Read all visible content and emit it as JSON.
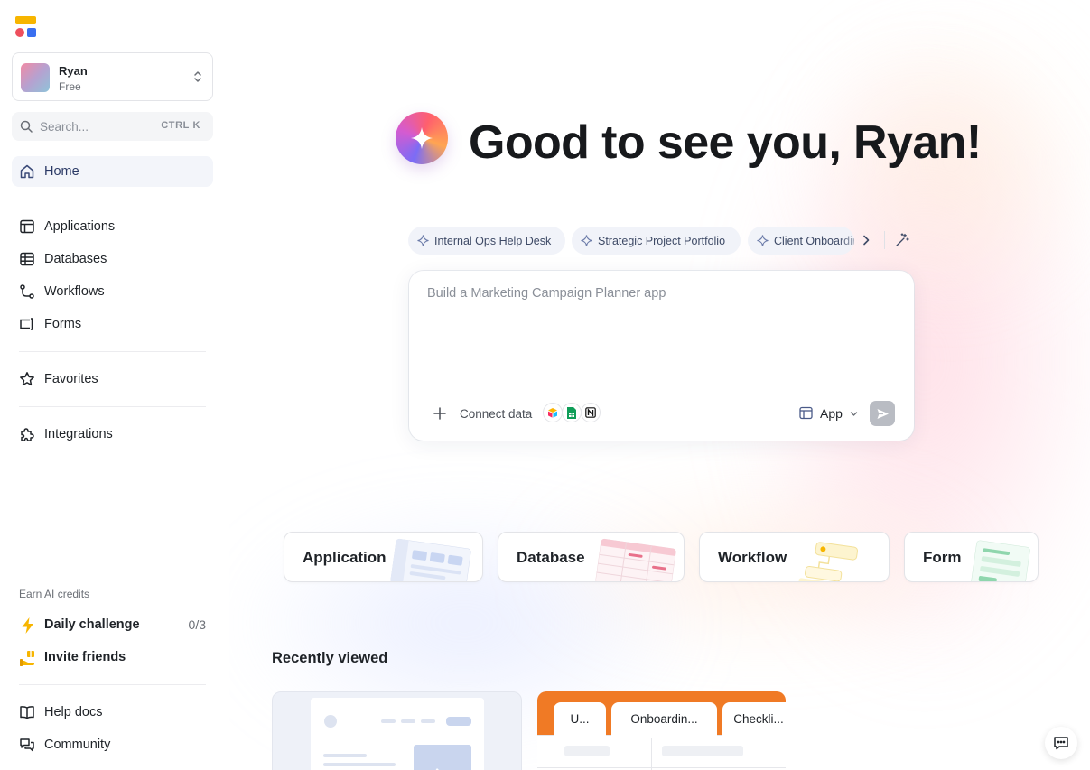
{
  "sidebar": {
    "workspace": {
      "name": "Ryan",
      "plan": "Free"
    },
    "search": {
      "placeholder": "Search...",
      "shortcut": "CTRL K"
    },
    "home": {
      "label": "Home",
      "icon": "home-icon"
    },
    "items": [
      {
        "label": "Applications",
        "icon": "applications-icon"
      },
      {
        "label": "Databases",
        "icon": "databases-icon"
      },
      {
        "label": "Workflows",
        "icon": "workflows-icon"
      },
      {
        "label": "Forms",
        "icon": "forms-icon"
      }
    ],
    "favorites": {
      "label": "Favorites",
      "icon": "star-icon"
    },
    "integrations": {
      "label": "Integrations",
      "icon": "puzzle-icon"
    },
    "earn": {
      "title": "Earn AI credits",
      "daily": {
        "label": "Daily challenge",
        "count": "0/3",
        "icon": "lightning-icon"
      },
      "invite": {
        "label": "Invite friends",
        "icon": "gift-hand-icon"
      }
    },
    "help": {
      "label": "Help docs",
      "icon": "book-icon"
    },
    "community": {
      "label": "Community",
      "icon": "chat-bubbles-icon"
    }
  },
  "main": {
    "greeting": "Good to see you, Ryan!",
    "suggestions": [
      {
        "label": "Internal Ops Help Desk"
      },
      {
        "label": "Strategic Project Portfolio"
      },
      {
        "label": "Client Onboarding"
      }
    ],
    "prompt": {
      "placeholder": "Build a Marketing Campaign Planner app",
      "connect_label": "Connect data",
      "type_label": "App"
    },
    "types": [
      {
        "label": "Application"
      },
      {
        "label": "Database"
      },
      {
        "label": "Workflow"
      },
      {
        "label": "Form"
      }
    ],
    "recent_title": "Recently viewed",
    "recent_tabs": [
      "U...",
      "Onboardin...",
      "Checkli..."
    ]
  },
  "colors": {
    "accent_orange": "#f07a25",
    "logo_yellow": "#f7b500",
    "logo_red": "#ee4f5d",
    "logo_blue": "#3a6ff0",
    "send_disabled": "#b9bcc3"
  }
}
